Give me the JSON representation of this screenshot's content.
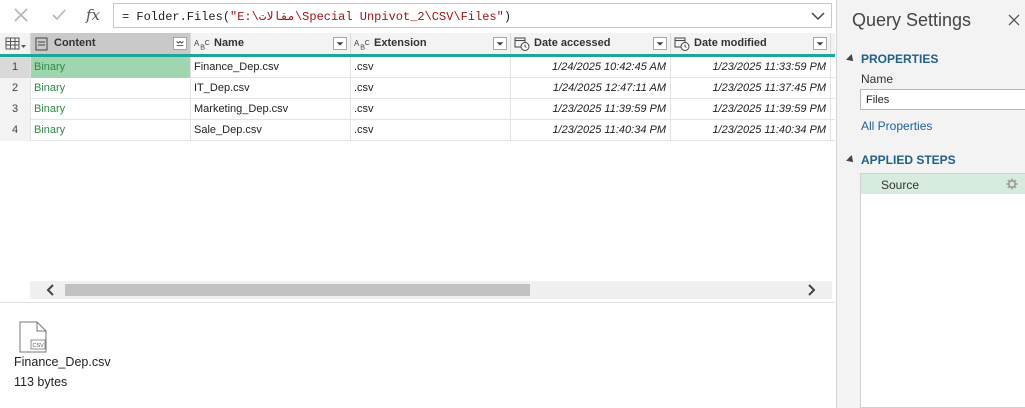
{
  "formula_bar": {
    "prefix": "= Folder.Files(",
    "path": "\"E:\\مقالات\\Special Unpivot_2\\CSV\\Files\"",
    "suffix": ")",
    "cancel_icon": "close-icon",
    "commit_icon": "check-icon",
    "fx_label": "fx"
  },
  "grid": {
    "columns": [
      {
        "label": "Content",
        "type_icon": "table-icon"
      },
      {
        "label": "Name",
        "type_icon": "text-type-icon"
      },
      {
        "label": "Extension",
        "type_icon": "text-type-icon"
      },
      {
        "label": "Date accessed",
        "type_icon": "datetime-type-icon"
      },
      {
        "label": "Date modified",
        "type_icon": "datetime-type-icon"
      }
    ],
    "rows": [
      {
        "num": "1",
        "content": "Binary",
        "name": "Finance_Dep.csv",
        "extension": ".csv",
        "accessed": "1/24/2025 10:42:45 AM",
        "modified": "1/23/2025 11:33:59 PM"
      },
      {
        "num": "2",
        "content": "Binary",
        "name": "IT_Dep.csv",
        "extension": ".csv",
        "accessed": "1/24/2025 12:47:11 AM",
        "modified": "1/23/2025 11:37:45 PM"
      },
      {
        "num": "3",
        "content": "Binary",
        "name": "Marketing_Dep.csv",
        "extension": ".csv",
        "accessed": "1/23/2025 11:39:59 PM",
        "modified": "1/23/2025 11:39:59 PM"
      },
      {
        "num": "4",
        "content": "Binary",
        "name": "Sale_Dep.csv",
        "extension": ".csv",
        "accessed": "1/23/2025 11:40:34 PM",
        "modified": "1/23/2025 11:40:34 PM"
      }
    ],
    "selected_row": 1,
    "accent_color": "#1fa69a",
    "binary_color": "#2f8a45"
  },
  "preview": {
    "icon": "csv-file-icon",
    "icon_label": "CSV",
    "file_name": "Finance_Dep.csv",
    "file_size": "113 bytes"
  },
  "query_settings": {
    "title": "Query Settings",
    "properties_heading": "PROPERTIES",
    "name_label": "Name",
    "name_value": "Files",
    "all_properties_link": "All Properties",
    "applied_steps_heading": "APPLIED STEPS",
    "steps": [
      {
        "label": "Source",
        "icon": "gear-icon"
      }
    ]
  }
}
